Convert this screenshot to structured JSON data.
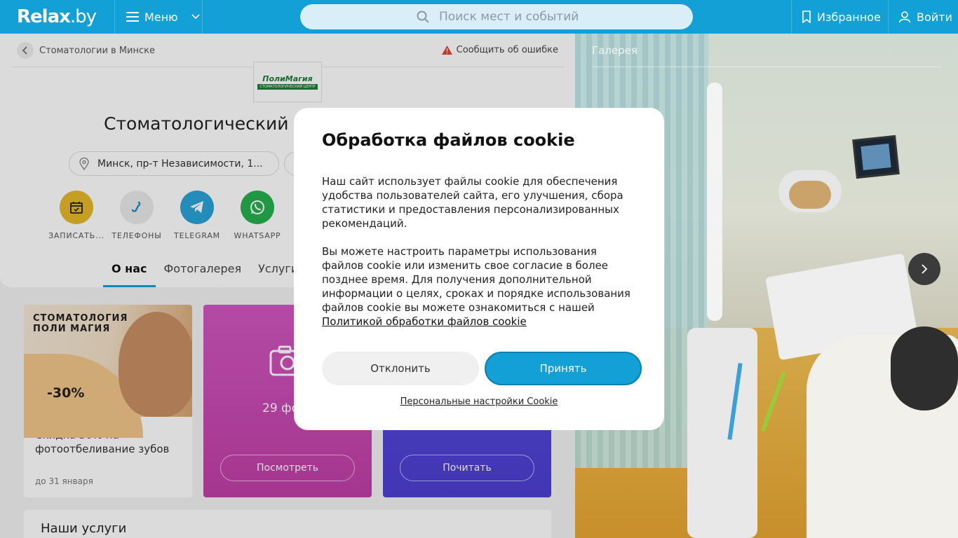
{
  "header": {
    "logo": "Relax",
    "logo_suffix": ".by",
    "menu_label": "Меню",
    "search_placeholder": "Поиск мест и событий",
    "favorites_label": "Избранное",
    "login_label": "Войти",
    "accent_color": "#12a0d7"
  },
  "place": {
    "breadcrumb": "Стоматологии в Минске",
    "report_label": "Сообщить об ошибке",
    "brand_logo_text": "ПолиМагия",
    "brand_logo_sub": "СТОМАТОЛОГИЧЕСКИЙ ЦЕНТР",
    "title": "Стоматологический ц",
    "address": "Минск, пр-т Независимости, 1...",
    "actions": [
      {
        "label": "ЗАПИСАТЬ...",
        "icon": "calendar-icon",
        "color": "#e8b92a"
      },
      {
        "label": "ТЕЛЕФОНЫ",
        "icon": "phone-icon",
        "color": "#ebebeb"
      },
      {
        "label": "TELEGRAM",
        "icon": "telegram-icon",
        "color": "#2aa3d8"
      },
      {
        "label": "WHATSAPP",
        "icon": "whatsapp-icon",
        "color": "#25b04e"
      }
    ],
    "tabs": [
      {
        "label": "О нас",
        "active": true
      },
      {
        "label": "Фотогалерея",
        "active": false
      },
      {
        "label": "Услуги",
        "active": false
      }
    ]
  },
  "promo": {
    "image_title_line1": "СТОМАТОЛОГИЯ",
    "image_title_line2": "ПОЛИ МАГИЯ",
    "discount": "-30%",
    "text": "Скидка 30% на фотоотбеливание зубов",
    "date": "до 31 января"
  },
  "photos_card": {
    "count": "29 фо",
    "button": "Посмотреть"
  },
  "reviews_card": {
    "button": "Почитать"
  },
  "services": {
    "title": "Наши услуги"
  },
  "gallery": {
    "title": "Галерея"
  },
  "cookie": {
    "title": "Обработка файлов cookie",
    "paragraph1": "Наш сайт использует файлы cookie для обеспечения удобства пользователей сайта, его улучшения, сбора статистики и предоставления персонализированных рекомендаций.",
    "paragraph2": "Вы можете настроить параметры использования файлов cookie или изменить свое согласие в более позднее время. Для получения дополнительной информации о целях, сроках и порядке использования файлов cookie вы можете ознакомиться с нашей",
    "policy_link": "Политикой обработки файлов cookie",
    "decline": "Отклонить",
    "accept": "Принять",
    "personal_settings": "Персональные настройки Cookie"
  }
}
